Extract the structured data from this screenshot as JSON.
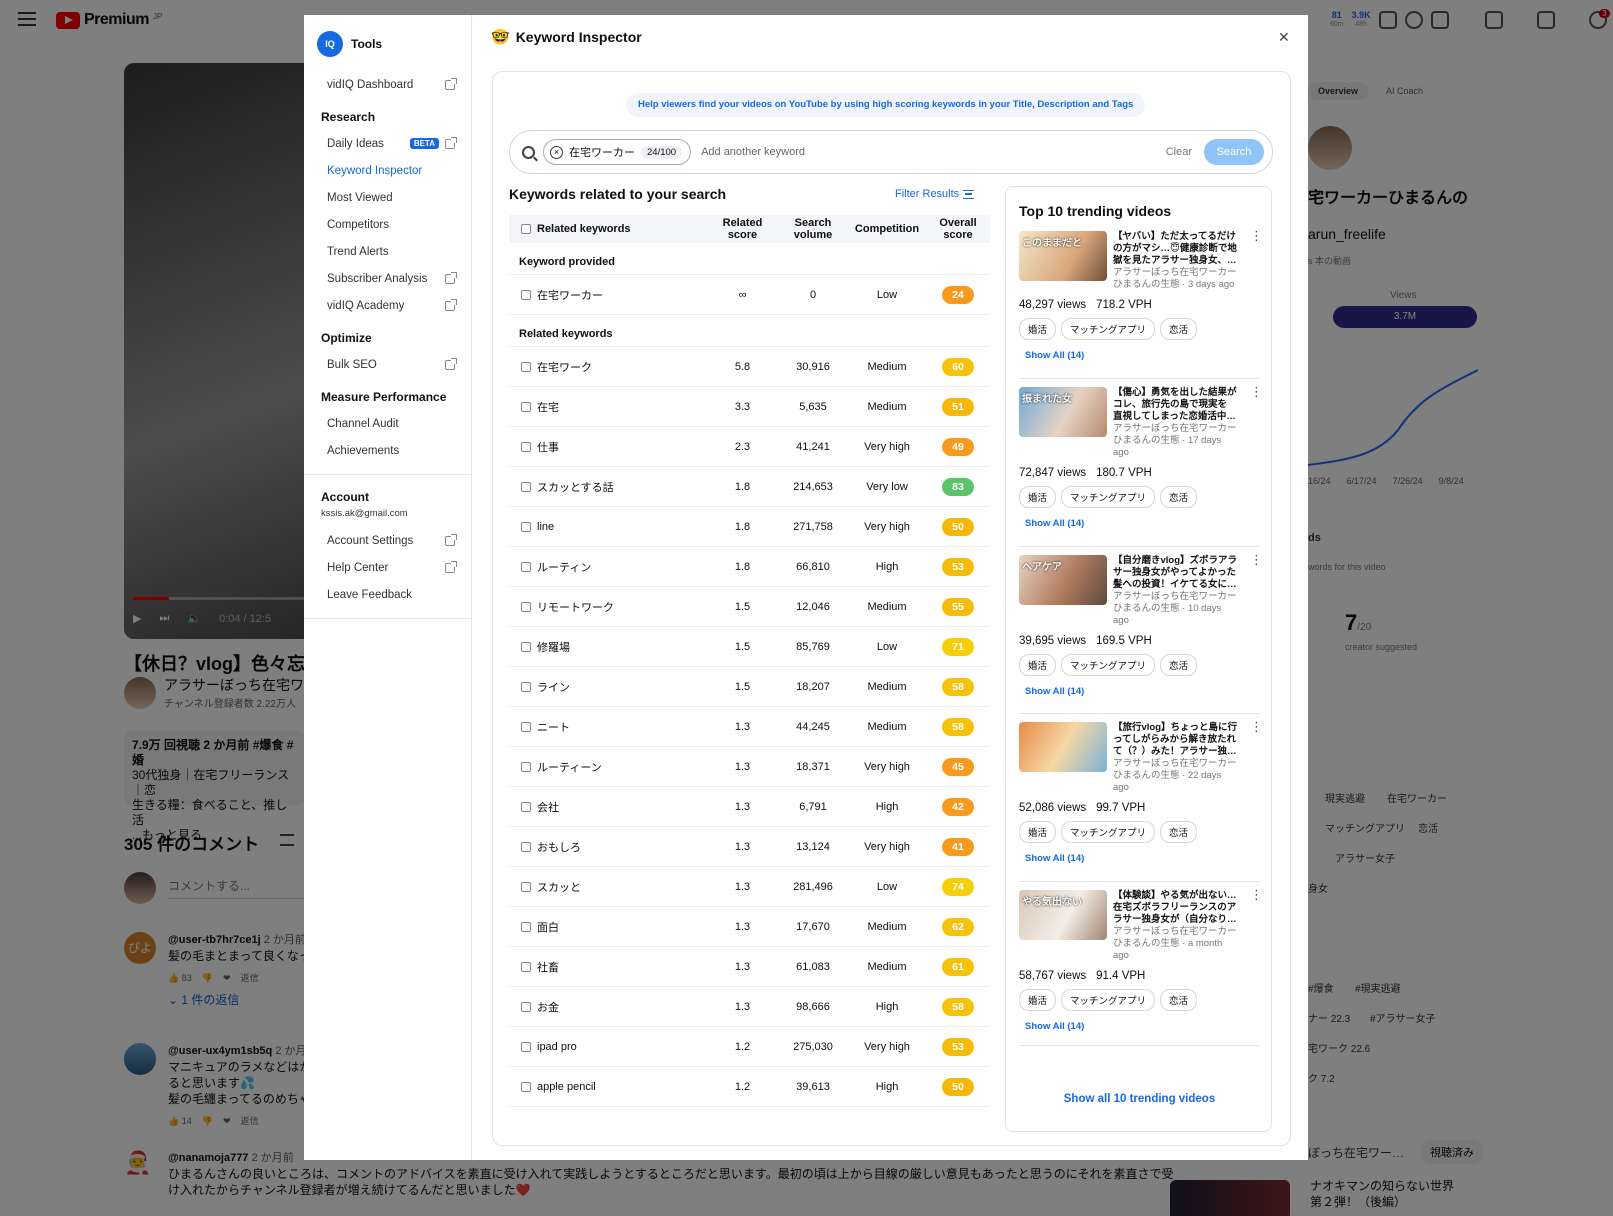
{
  "youtube": {
    "logo": "Premium",
    "logo_region": "JP",
    "topbar_stats": [
      {
        "value": "81",
        "sub": "60m"
      },
      {
        "value": "3.9K",
        "sub": "48h"
      }
    ],
    "notifications": "3",
    "video_time": "0:04 / 12:5",
    "title": "【休日？vlog】色々忘れて",
    "channel": "アラサーぼっち在宅ワー",
    "subs": "チャンネル登録者数 2.22万人",
    "desc": [
      "7.9万 回視聴 2 か月前 #爆食 #婚",
      "30代独身｜在宅フリーランス｜恋",
      "生きる糧：食べること、推し活",
      "...もっと見る"
    ],
    "comments_title": "305 件のコメント",
    "comment_placeholder": "コメントする...",
    "comments": [
      {
        "handle": "@user-tb7hr7ce1j",
        "time": "2 か月前",
        "text": "髪の毛まとまって良くなっ",
        "likes": "83",
        "reply": "返信",
        "replies": "1 件の返信",
        "avatar": "ぴよ"
      },
      {
        "handle": "@user-ux4ym1sb5q",
        "time": "2 か月前",
        "text": "マニキュアのラメなどはか",
        "text2": "ると思います💦",
        "text3": "髪の毛纏まってるのめちゃ",
        "likes": "14",
        "reply": "返信"
      }
    ],
    "bottom_comment": {
      "handle": "@nanamoja777",
      "time": "2 か月前",
      "text": "ひまるんさんの良いところは、コメントのアドバイスを素直に受け入れて実践しようとするところだと思います。最初の頃は上から目線の厳しい意見もあったと思うのにそれを素直さで受",
      "text2": "け入れたからチャンネル登録者が増え続けてるんだと思いました❤️"
    },
    "right_panel": {
      "tabs": [
        "Overview",
        "AI Coach"
      ],
      "channel_name": "宅ワーカーひまるんの",
      "channel_handle": "arun_freelife",
      "this_video": "s 本の動画",
      "views_label": "Views",
      "views": "3.7M",
      "axis": [
        "16/24",
        "6/17/24",
        "7/26/24",
        "9/8/24"
      ],
      "section_letters": "ds",
      "words_note": "words for this video",
      "score": "7",
      "score_of": "/20",
      "score_note": "creator suggested",
      "tags_a": [
        "現実逃避",
        "在宅ワーカー",
        "マッチングアプリ",
        "恋活",
        "アラサー女子",
        "身女"
      ],
      "tags_b": [
        "#爆食",
        "#現実逃避",
        "ナー 22.3",
        "#アラサー女子",
        "宅ワーク 22.6",
        "ク 7.2"
      ],
      "rec_channel": "ぼっち在宅ワー…",
      "watched": "視聴済み",
      "rec_title": "ナオキマンの知らない世界第２弾！（後編）"
    }
  },
  "sidebar": {
    "tools_label": "Tools",
    "logo_text": "IQ",
    "dashboard": "vidIQ Dashboard",
    "research_heading": "Research",
    "research_items": [
      "Daily Ideas",
      "Keyword Inspector",
      "Most Viewed",
      "Competitors",
      "Trend Alerts",
      "Subscriber Analysis",
      "vidIQ Academy"
    ],
    "beta_label": "BETA",
    "optimize_heading": "Optimize",
    "bulk_seo": "Bulk SEO",
    "measure_heading": "Measure Performance",
    "channel_audit": "Channel Audit",
    "achievements": "Achievements",
    "account_heading": "Account",
    "email": "kssis.ak@gmail.com",
    "account_settings": "Account Settings",
    "help_center": "Help Center",
    "leave_feedback": "Leave Feedback"
  },
  "main": {
    "title": "Keyword Inspector",
    "title_emoji": "🤓",
    "help_banner": "Help viewers find your videos on YouTube by using high scoring keywords in your Title, Description and Tags",
    "chip_keyword": "在宅ワーカー",
    "chip_count": "24/100",
    "add_placeholder": "Add another keyword",
    "clear_label": "Clear",
    "search_label": "Search",
    "keywords_title": "Keywords related to your search",
    "filter_label": "Filter Results",
    "headers": {
      "keywords": "Related keywords",
      "related_score_1": "Related",
      "related_score_2": "score",
      "search_volume_1": "Search",
      "search_volume_2": "volume",
      "competition": "Competition",
      "overall_1": "Overall",
      "overall_2": "score"
    },
    "provided_heading": "Keyword provided",
    "provided": {
      "kw": "在宅ワーカー",
      "rs": "∞",
      "sv": "0",
      "cp": "Low",
      "os": "24",
      "color": "#f79a1e"
    },
    "related_heading": "Related keywords",
    "rows": [
      {
        "kw": "在宅ワーク",
        "rs": "5.8",
        "sv": "30,916",
        "cp": "Medium",
        "os": "60",
        "color": "#f5c30a"
      },
      {
        "kw": "在宅",
        "rs": "3.3",
        "sv": "5,635",
        "cp": "Medium",
        "os": "51",
        "color": "#f5b80a"
      },
      {
        "kw": "仕事",
        "rs": "2.3",
        "sv": "41,241",
        "cp": "Very high",
        "os": "49",
        "color": "#f79a1e"
      },
      {
        "kw": "スカッとする話",
        "rs": "1.8",
        "sv": "214,653",
        "cp": "Very low",
        "os": "83",
        "color": "#5cc36a"
      },
      {
        "kw": "line",
        "rs": "1.8",
        "sv": "271,758",
        "cp": "Very high",
        "os": "50",
        "color": "#f5b80a"
      },
      {
        "kw": "ルーティン",
        "rs": "1.8",
        "sv": "66,810",
        "cp": "High",
        "os": "53",
        "color": "#f5bd0a"
      },
      {
        "kw": "リモートワーク",
        "rs": "1.5",
        "sv": "12,046",
        "cp": "Medium",
        "os": "55",
        "color": "#f5bd0a"
      },
      {
        "kw": "修羅場",
        "rs": "1.5",
        "sv": "85,769",
        "cp": "Low",
        "os": "71",
        "color": "#f5d00a"
      },
      {
        "kw": "ライン",
        "rs": "1.5",
        "sv": "18,207",
        "cp": "Medium",
        "os": "58",
        "color": "#f5c30a"
      },
      {
        "kw": "ニート",
        "rs": "1.3",
        "sv": "44,245",
        "cp": "Medium",
        "os": "58",
        "color": "#f5c30a"
      },
      {
        "kw": "ルーティーン",
        "rs": "1.3",
        "sv": "18,371",
        "cp": "Very high",
        "os": "45",
        "color": "#f79a1e"
      },
      {
        "kw": "会社",
        "rs": "1.3",
        "sv": "6,791",
        "cp": "High",
        "os": "42",
        "color": "#f79a1e"
      },
      {
        "kw": "おもしろ",
        "rs": "1.3",
        "sv": "13,124",
        "cp": "Very high",
        "os": "41",
        "color": "#f79a1e"
      },
      {
        "kw": "スカッと",
        "rs": "1.3",
        "sv": "281,496",
        "cp": "Low",
        "os": "74",
        "color": "#f5d00a"
      },
      {
        "kw": "面白",
        "rs": "1.3",
        "sv": "17,670",
        "cp": "Medium",
        "os": "62",
        "color": "#f5c30a"
      },
      {
        "kw": "社畜",
        "rs": "1.3",
        "sv": "61,083",
        "cp": "Medium",
        "os": "61",
        "color": "#f5c30a"
      },
      {
        "kw": "お金",
        "rs": "1.3",
        "sv": "98,666",
        "cp": "High",
        "os": "58",
        "color": "#f5c30a"
      },
      {
        "kw": "ipad pro",
        "rs": "1.2",
        "sv": "275,030",
        "cp": "Very high",
        "os": "53",
        "color": "#f5bd0a"
      },
      {
        "kw": "apple pencil",
        "rs": "1.2",
        "sv": "39,613",
        "cp": "High",
        "os": "50",
        "color": "#f5b80a"
      }
    ],
    "trending_title": "Top 10 trending videos",
    "trending": [
      {
        "t1": "【ヤバい】ただ太ってるだけ",
        "t2": "の方がマシ…😇健康診断で地",
        "t3": "獄を見たアラサー独身女、…",
        "c1": "アラサーぼっち在宅ワーカー",
        "c2": "ひまるんの生態 · 3 days ago",
        "c3": "",
        "views": "48,297 views",
        "vph": "718.2 VPH",
        "thumb_text": "このままだと",
        "thumb": "linear-gradient(120deg,#f3e7c9,#d9a77b 60%,#704f3a)"
      },
      {
        "t1": "【傷心】勇気を出した結果が",
        "t2": "コレ、旅行先の島で現実を",
        "t3": "直視してしまった恋婚活中…",
        "c1": "アラサーぼっち在宅ワーカー",
        "c2": "ひまるんの生態 · 17 days",
        "c3": "ago",
        "views": "72,847 views",
        "vph": "180.7 VPH",
        "thumb_text": "振まれた女",
        "thumb": "linear-gradient(120deg,#6fa9d8,#e6d3c4 55%,#b68a6e)"
      },
      {
        "t1": "【自分磨きvlog】ズボラアラ",
        "t2": "サー独身女がやってよかった",
        "t3": "髪への投資！イケてる女に…",
        "c1": "アラサーぼっち在宅ワーカー",
        "c2": "ひまるんの生態 · 10 days",
        "c3": "ago",
        "views": "39,695 views",
        "vph": "169.5 VPH",
        "thumb_text": "ヘアケア",
        "thumb": "linear-gradient(120deg,#e8d3c2,#b07b5f 55%,#5d4a3f)"
      },
      {
        "t1": "【旅行vlog】ちょっと島に行",
        "t2": "ってしがらみから解き放たれ",
        "t3": "て（？）みた！アラサー独…",
        "c1": "アラサーぼっち在宅ワーカー",
        "c2": "ひまるんの生態 · 22 days",
        "c3": "ago",
        "views": "52,086 views",
        "vph": "99.7 VPH",
        "thumb_text": "",
        "thumb": "linear-gradient(120deg,#e98a4a,#f5d8a3 50%,#7bb2d8)"
      },
      {
        "t1": "【体験談】やる気が出ない…",
        "t2": "在宅ズボラフリーランスのア",
        "t3": "ラサー独身女が（自分なり…",
        "c1": "アラサーぼっち在宅ワーカー",
        "c2": "ひまるんの生態 · a month",
        "c3": "ago",
        "views": "58,767 views",
        "vph": "91.4 VPH",
        "thumb_text": "やる気出ない",
        "thumb": "linear-gradient(120deg,#d9c7b7,#f4ede6 55%,#a08573)"
      }
    ],
    "video_tags": [
      "婚活",
      "マッチングアプリ",
      "恋活"
    ],
    "show_all_tags": "Show All (14)",
    "show_all_videos": "Show all 10 trending videos"
  }
}
